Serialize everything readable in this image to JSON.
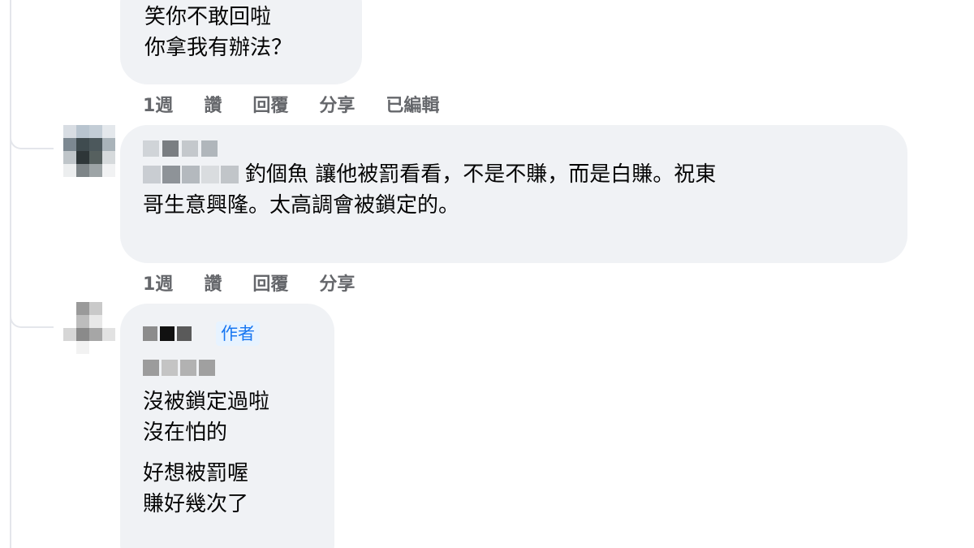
{
  "comments": [
    {
      "lines": [
        "笑你不敢回啦",
        "你拿我有辦法？"
      ],
      "meta": [
        "1週",
        "讚",
        "回覆",
        "分享",
        "已編輯"
      ]
    },
    {
      "text_line1": "釣個魚 讓他被罰看看，不是不賺，而是白賺。祝東",
      "text_line2": "哥生意興隆。太高調會被鎖定的。",
      "meta": [
        "1週",
        "讚",
        "回覆",
        "分享"
      ]
    },
    {
      "badge": "作者",
      "para1": [
        "沒被鎖定過啦",
        "沒在怕的"
      ],
      "para2": [
        "好想被罰喔",
        "賺好幾次了"
      ]
    }
  ]
}
